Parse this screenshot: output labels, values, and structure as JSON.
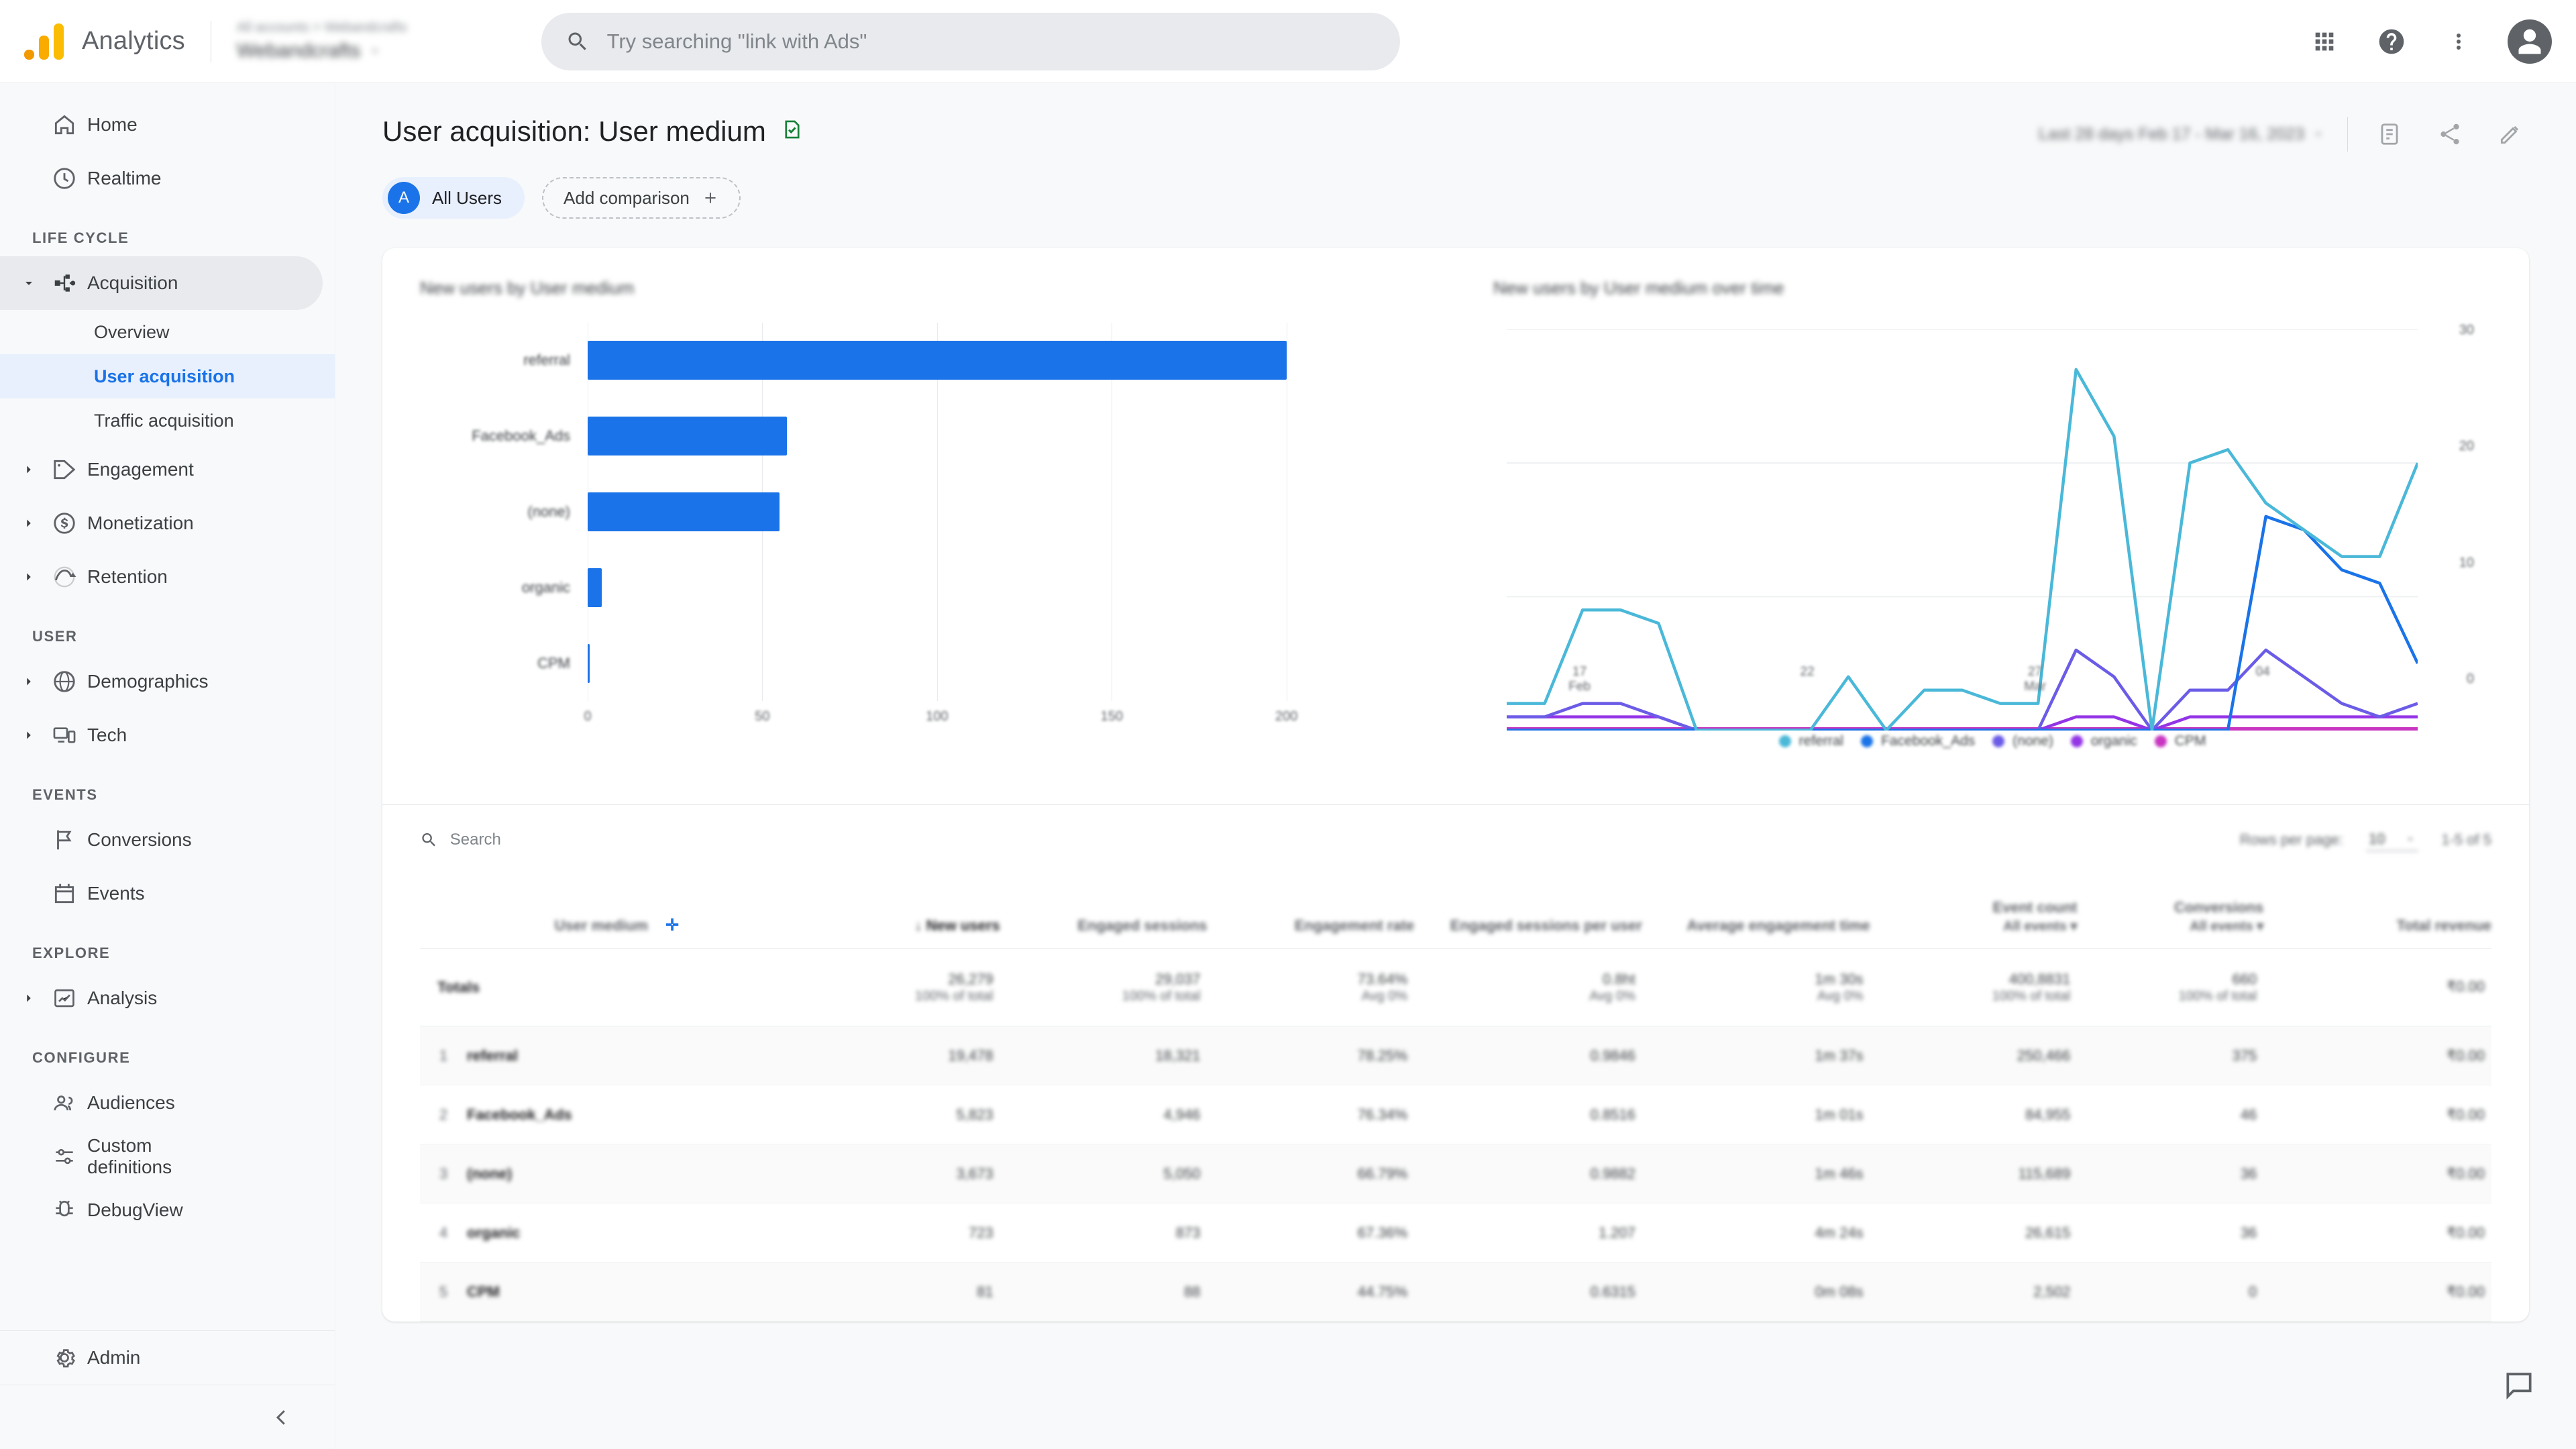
{
  "topbar": {
    "brand": "Analytics",
    "account_breadcrumb": "All accounts > Webandcrafts",
    "property_name": "Webandcrafts",
    "search_placeholder": "Try searching \"link with Ads\"",
    "icons": [
      "apps-grid-icon",
      "help-icon",
      "more-vert-icon",
      "account-avatar"
    ]
  },
  "sidebar": {
    "items": [
      {
        "label": "Home",
        "icon": "home-icon",
        "expandable": false
      },
      {
        "label": "Realtime",
        "icon": "clock-icon",
        "expandable": false
      }
    ],
    "sections": [
      {
        "title": "LIFE CYCLE",
        "items": [
          {
            "label": "Acquisition",
            "icon": "acquisition-icon",
            "expandable": true,
            "expanded": true,
            "active": true,
            "children": [
              {
                "label": "Overview",
                "selected": false
              },
              {
                "label": "User acquisition",
                "selected": true
              },
              {
                "label": "Traffic acquisition",
                "selected": false
              }
            ]
          },
          {
            "label": "Engagement",
            "icon": "tag-icon",
            "expandable": true
          },
          {
            "label": "Monetization",
            "icon": "money-icon",
            "expandable": true
          },
          {
            "label": "Retention",
            "icon": "retention-icon",
            "expandable": true
          }
        ]
      },
      {
        "title": "USER",
        "items": [
          {
            "label": "Demographics",
            "icon": "globe-icon",
            "expandable": true
          },
          {
            "label": "Tech",
            "icon": "devices-icon",
            "expandable": true
          }
        ]
      },
      {
        "title": "EVENTS",
        "items": [
          {
            "label": "Conversions",
            "icon": "flag-icon",
            "expandable": false
          },
          {
            "label": "Events",
            "icon": "event-icon",
            "expandable": false
          }
        ]
      },
      {
        "title": "EXPLORE",
        "items": [
          {
            "label": "Analysis",
            "icon": "analysis-icon",
            "expandable": true
          }
        ]
      },
      {
        "title": "CONFIGURE",
        "items": [
          {
            "label": "Audiences",
            "icon": "audiences-icon",
            "expandable": false
          },
          {
            "label": "Custom definitions",
            "icon": "custom-definitions-icon",
            "expandable": false
          },
          {
            "label": "DebugView",
            "icon": "debug-icon",
            "expandable": false
          }
        ]
      }
    ],
    "admin": {
      "label": "Admin",
      "icon": "gear-icon"
    },
    "collapse_icon": "chevron-left-icon"
  },
  "page": {
    "title": "User acquisition: User medium",
    "title_badge_icon": "saved-report-check-icon",
    "date_range": "Last 28 days  Feb 17 - Mar 16, 2023",
    "header_icons": [
      "insights-icon",
      "share-icon",
      "edit-icon"
    ],
    "comparison": {
      "all_users_initial": "A",
      "all_users_label": "All Users",
      "add_label": "Add comparison",
      "add_icon": "plus-icon"
    }
  },
  "chart_data": [
    {
      "type": "bar",
      "title": "New users by User medium",
      "orientation": "horizontal",
      "categories": [
        "referral",
        "Facebook_Ads",
        "(none)",
        "organic",
        "CPM"
      ],
      "values": [
        200,
        57,
        55,
        4,
        0.4
      ],
      "xlabel": "",
      "ylabel": "User medium",
      "xlim": [
        0,
        230
      ],
      "xticks": [
        "0",
        "50",
        "100",
        "150",
        "200"
      ],
      "bar_color": "#1a73e8",
      "grid": true
    },
    {
      "type": "line",
      "title": "New users by User medium over time",
      "xlabel": "",
      "ylabel": "New users",
      "ylim": [
        0,
        30
      ],
      "yticks": [
        "0",
        "10",
        "20",
        "30"
      ],
      "xticks": [
        {
          "line1": "17",
          "line2": "Feb"
        },
        {
          "line1": "22",
          "line2": ""
        },
        {
          "line1": "27",
          "line2": "Mar"
        },
        {
          "line1": "04",
          "line2": ""
        }
      ],
      "grid": true,
      "legend_position": "bottom",
      "series": [
        {
          "name": "referral",
          "color": "#4ab8d8",
          "values": [
            2,
            2,
            9,
            9,
            8,
            0,
            0,
            0,
            0,
            4,
            0,
            3,
            3,
            2,
            2,
            27,
            22,
            0,
            20,
            21,
            17,
            15,
            13,
            13,
            20
          ]
        },
        {
          "name": "Facebook_Ads",
          "color": "#1a73e8",
          "values": [
            0,
            0,
            0,
            0,
            0,
            0,
            0,
            0,
            0,
            0,
            0,
            0,
            0,
            0,
            0,
            0,
            0,
            0,
            0,
            0,
            16,
            15,
            12,
            11,
            5
          ]
        },
        {
          "name": "(none)",
          "color": "#6b5ce7",
          "values": [
            1,
            1,
            2,
            2,
            1,
            0,
            0,
            0,
            0,
            0,
            0,
            0,
            0,
            0,
            0,
            6,
            4,
            0,
            3,
            3,
            6,
            4,
            2,
            1,
            2
          ]
        },
        {
          "name": "organic",
          "color": "#9334e6",
          "values": [
            1,
            1,
            1,
            1,
            1,
            0,
            0,
            0,
            0,
            0,
            0,
            0,
            0,
            0,
            0,
            1,
            1,
            0,
            1,
            1,
            1,
            1,
            1,
            1,
            1
          ]
        },
        {
          "name": "CPM",
          "color": "#c935c1",
          "values": [
            0,
            0,
            0,
            0,
            0,
            0,
            0,
            0,
            0,
            0,
            0,
            0,
            0,
            0,
            0,
            0,
            0,
            0,
            0,
            0,
            0,
            0,
            0,
            0,
            0
          ]
        }
      ]
    }
  ],
  "table": {
    "search_placeholder": "Search",
    "rows_per_page_label": "Rows per page:",
    "rows_per_page_value": "10",
    "range_text": "1-5 of 5",
    "columns": [
      {
        "label": "User medium",
        "sub": "",
        "align": "left",
        "sortable": true,
        "plus_icon": "add-dimension-icon"
      },
      {
        "label": "New users",
        "sub": "",
        "align": "right",
        "sorted": true
      },
      {
        "label": "Engaged sessions",
        "sub": "",
        "align": "right"
      },
      {
        "label": "Engagement rate",
        "sub": "",
        "align": "right"
      },
      {
        "label": "Engaged sessions per user",
        "sub": "",
        "align": "right"
      },
      {
        "label": "Average engagement time",
        "sub": "",
        "align": "right"
      },
      {
        "label": "Event count",
        "sub": "All events ▾",
        "align": "right"
      },
      {
        "label": "Conversions",
        "sub": "All events ▾",
        "align": "right"
      },
      {
        "label": "Total revenue",
        "sub": "",
        "align": "right"
      }
    ],
    "totals": {
      "label": "Totals",
      "values": [
        {
          "main": "26,279",
          "sub": "100% of total"
        },
        {
          "main": "29,037",
          "sub": "100% of total"
        },
        {
          "main": "73.64%",
          "sub": "Avg 0%"
        },
        {
          "main": "0.8ht",
          "sub": "Avg 0%"
        },
        {
          "main": "1m 30s",
          "sub": "Avg 0%"
        },
        {
          "main": "400,8831",
          "sub": "100% of total"
        },
        {
          "main": "660",
          "sub": "100% of total"
        },
        {
          "main": "₹0.00",
          "sub": ""
        }
      ]
    },
    "rows": [
      {
        "index": "1",
        "dimension": "referral",
        "cells": [
          "19,478",
          "18,321",
          "78.25%",
          "0.9846",
          "1m 37s",
          "250,466",
          "375",
          "₹0.00"
        ]
      },
      {
        "index": "2",
        "dimension": "Facebook_Ads",
        "cells": [
          "5,823",
          "4,946",
          "76.34%",
          "0.8516",
          "1m 01s",
          "84,955",
          "46",
          "₹0.00"
        ]
      },
      {
        "index": "3",
        "dimension": "(none)",
        "cells": [
          "3,673",
          "5,050",
          "66.79%",
          "0.9882",
          "1m 46s",
          "115,689",
          "36",
          "₹0.00"
        ]
      },
      {
        "index": "4",
        "dimension": "organic",
        "cells": [
          "723",
          "873",
          "67.36%",
          "1.207",
          "4m 24s",
          "26,615",
          "36",
          "₹0.00"
        ]
      },
      {
        "index": "5",
        "dimension": "CPM",
        "cells": [
          "81",
          "88",
          "44.75%",
          "0.6315",
          "0m 08s",
          "2,502",
          "0",
          "₹0.00"
        ]
      }
    ]
  },
  "feedback": {
    "icon": "feedback-icon"
  }
}
